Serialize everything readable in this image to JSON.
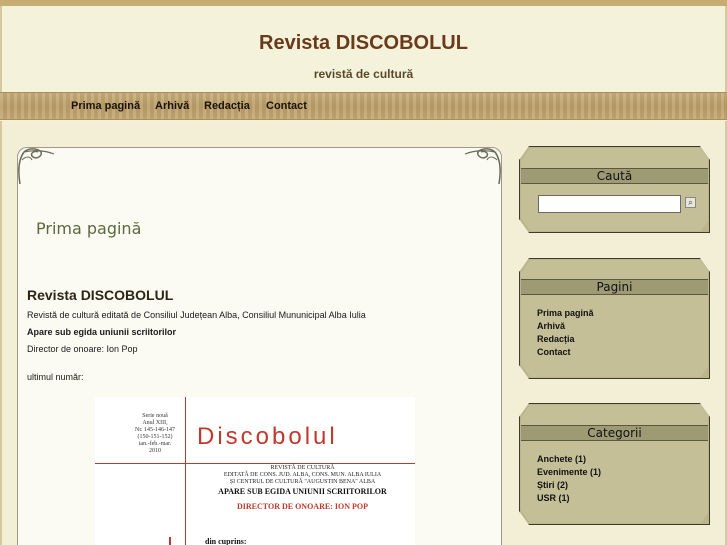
{
  "site": {
    "title": "Revista DISCOBOLUL",
    "subtitle": "revistă de cultură"
  },
  "nav": {
    "items": [
      {
        "label": "Prima pagină"
      },
      {
        "label": "Arhivă"
      },
      {
        "label": "Redacția"
      },
      {
        "label": "Contact"
      }
    ]
  },
  "content": {
    "page_heading": "Prima pagină",
    "post_title": "Revista DISCOBOLUL",
    "line1": "Revistă de cultură editată de Consiliul Județean Alba, Consiliul Mununicipal Alba Iulia",
    "line2": "Apare sub egida uniunii scriitorilor",
    "line3": "Director de onoare: Ion Pop",
    "line4": "ultimul număr:",
    "cover": {
      "series_lines": [
        "Serie nouă",
        "Anul XIII,",
        "Nr. 145-146-147",
        "(150-151-152)",
        "ian.-feb.-mar.",
        "2010"
      ],
      "title": "Discobolul",
      "info_lines": [
        "REVISTĂ DE CULTURĂ",
        "EDITATĂ DE CONS. JUD. ALBA, CONS. MUN. ALBA IULIA",
        "ȘI CENTRUL DE CULTURĂ \"AUGUSTIN BENA\" ALBA"
      ],
      "egida": "APARE SUB EGIDA UNIUNII SCRIITORILOR",
      "director": "DIRECTOR DE ONOARE: ION POP",
      "cuprins": "din cuprins:"
    }
  },
  "sidebar": {
    "search": {
      "title": "Caută",
      "value": "",
      "button_icon": "magnifier-icon"
    },
    "pages": {
      "title": "Pagini",
      "items": [
        {
          "label": "Prima pagină"
        },
        {
          "label": "Arhivă"
        },
        {
          "label": "Redacția"
        },
        {
          "label": "Contact"
        }
      ]
    },
    "categories": {
      "title": "Categorii",
      "items": [
        {
          "label": "Anchete (1)"
        },
        {
          "label": "Evenimente (1)"
        },
        {
          "label": "Știri (2)"
        },
        {
          "label": "USR (1)"
        }
      ]
    }
  },
  "colors": {
    "title": "#6a3a1b",
    "heading": "#5b6a3b",
    "navbar": "#c3a774",
    "widget": "#c4bf97",
    "cover_accent": "#c0392b"
  }
}
